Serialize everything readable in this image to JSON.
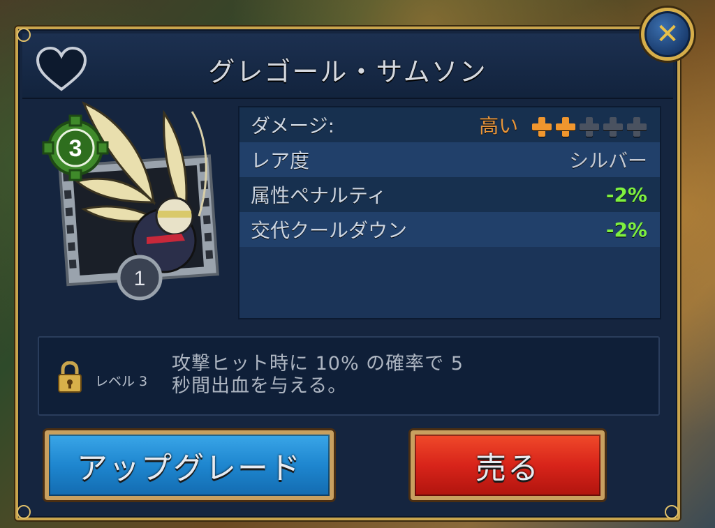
{
  "window": {
    "title": "グレゴール・サムソン",
    "close_symbol": "✕"
  },
  "portrait": {
    "tier_badge": "3",
    "slot_number": "1",
    "character_icon": "winged-fighter-portrait"
  },
  "stats": [
    {
      "label": "ダメージ:",
      "value": "高い",
      "value_color": "#e8953a",
      "rating": {
        "filled": 2,
        "total": 5
      }
    },
    {
      "label": "レア度",
      "value": "シルバー",
      "value_color": "#c4cad4"
    },
    {
      "label": "属性ペナルティ",
      "value": "-2%",
      "value_color": "#7ef040"
    },
    {
      "label": "交代クールダウン",
      "value": "-2%",
      "value_color": "#7ef040"
    }
  ],
  "ability": {
    "lock_icon": "lock-icon",
    "level_label": "レベル 3",
    "line1": "攻撃ヒット時に 10% の確率で 5",
    "line2": "秒間出血を与える。"
  },
  "buttons": {
    "upgrade_label": "アップグレード",
    "sell_label": "売る"
  },
  "colors": {
    "panel": "#15253f",
    "gold_border": "#c9a54d",
    "upgrade": "#1e86cf",
    "sell": "#d8241a"
  }
}
